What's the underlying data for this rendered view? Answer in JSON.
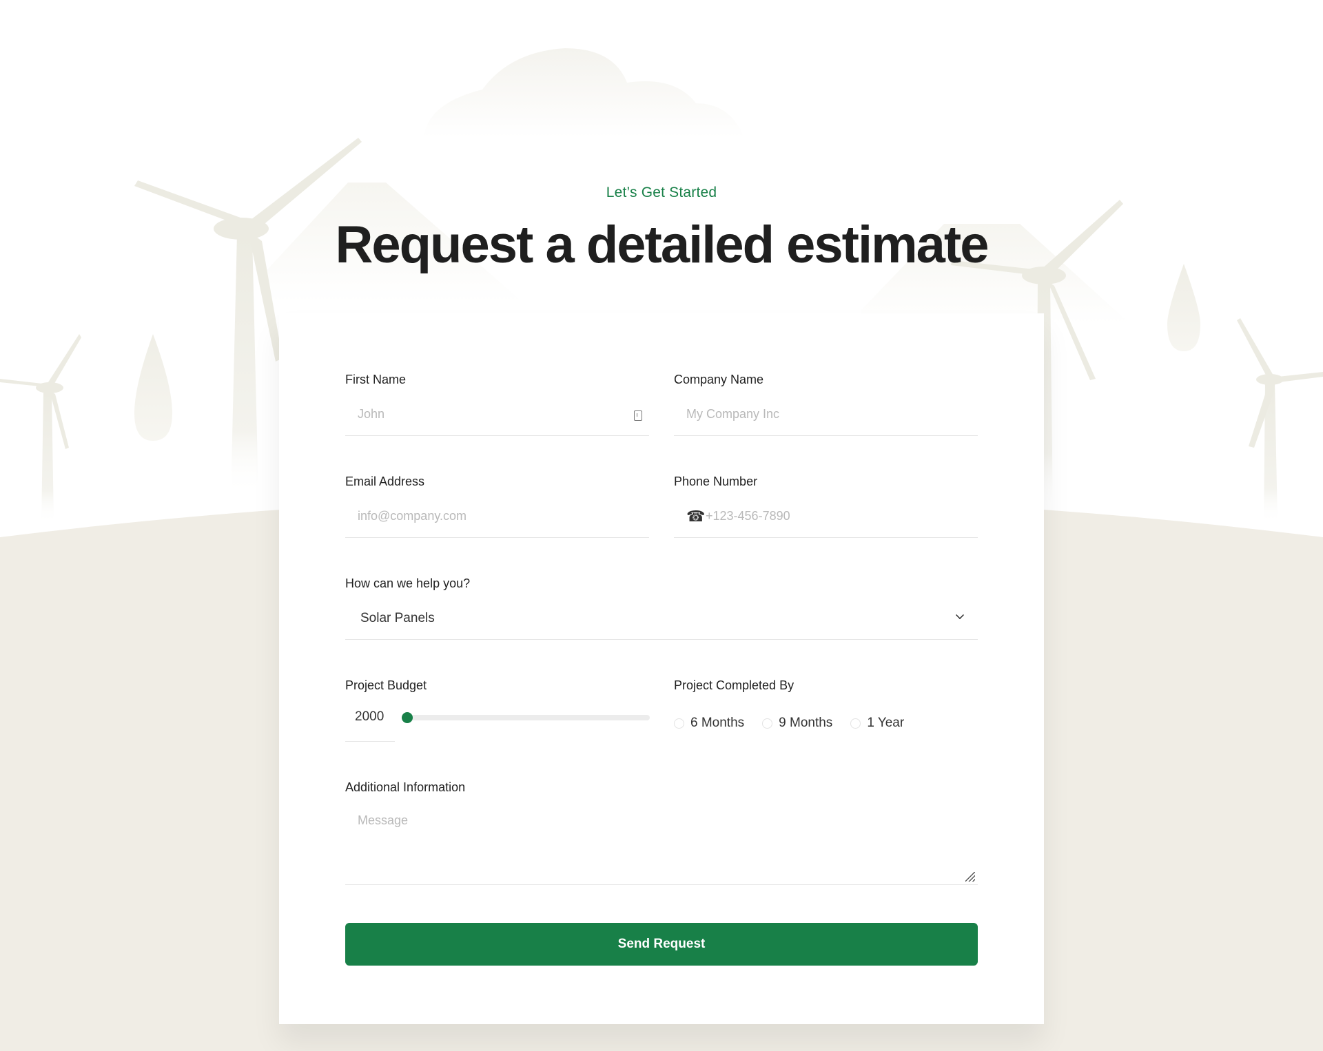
{
  "header": {
    "eyebrow": "Let’s Get Started",
    "title": "Request a detailed estimate"
  },
  "form": {
    "first_name": {
      "label": "First Name",
      "placeholder": "John"
    },
    "company_name": {
      "label": "Company Name",
      "placeholder": "My Company Inc"
    },
    "email": {
      "label": "Email Address",
      "placeholder": "info@company.com"
    },
    "phone": {
      "label": "Phone Number",
      "placeholder": "+123-456-7890"
    },
    "help": {
      "label": "How can we help you?",
      "selected": "Solar Panels"
    },
    "budget": {
      "label": "Project Budget",
      "value": "2000",
      "slider_fraction": 0
    },
    "completion": {
      "label": "Project Completed By",
      "options": [
        "6 Months",
        "9 Months",
        "1 Year"
      ]
    },
    "additional": {
      "label": "Additional Information",
      "placeholder": "Message"
    },
    "submit_label": "Send Request"
  },
  "colors": {
    "accent": "#188048",
    "ground": "#f0ede5",
    "silhouette": "#ecebe2"
  },
  "icons": {
    "first_name": "contact-card-icon",
    "phone": "telephone-icon",
    "help": "chevron-down-icon"
  }
}
